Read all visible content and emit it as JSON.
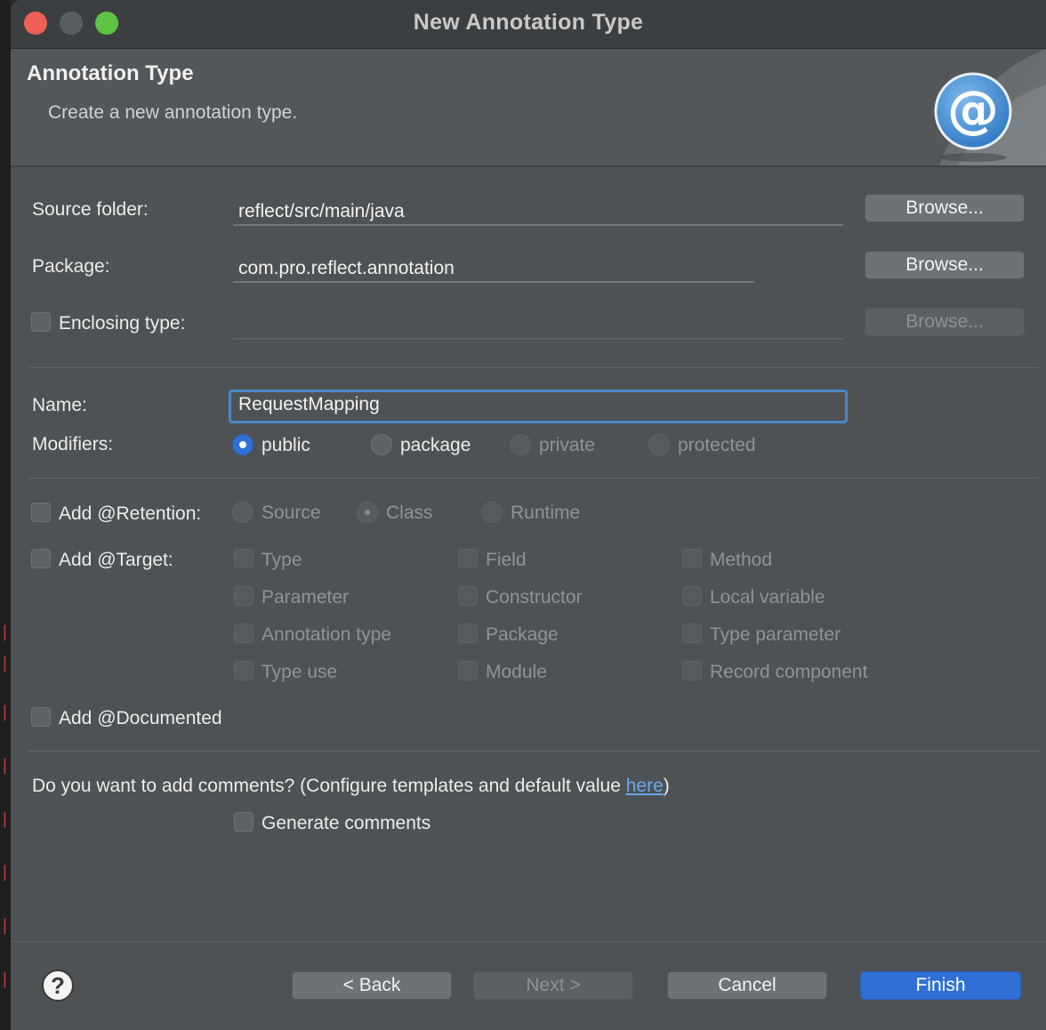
{
  "window": {
    "title": "New Annotation Type"
  },
  "header": {
    "title": "Annotation Type",
    "description": "Create a new annotation type.",
    "icon": "at-sign-icon"
  },
  "source_folder": {
    "label": "Source folder:",
    "value": "reflect/src/main/java",
    "browse": "Browse..."
  },
  "package": {
    "label": "Package:",
    "value": "com.pro.reflect.annotation",
    "browse": "Browse..."
  },
  "enclosing": {
    "label": "Enclosing type:",
    "value": "",
    "browse": "Browse...",
    "checked": false
  },
  "name": {
    "label": "Name:",
    "value": "RequestMapping"
  },
  "modifiers": {
    "label": "Modifiers:",
    "options": [
      "public",
      "package",
      "private",
      "protected"
    ],
    "selected": "public"
  },
  "retention": {
    "label": "Add @Retention:",
    "options": [
      "Source",
      "Class",
      "Runtime"
    ],
    "selected": "Class"
  },
  "target": {
    "label": "Add @Target:",
    "options": [
      "Type",
      "Field",
      "Method",
      "Parameter",
      "Constructor",
      "Local variable",
      "Annotation type",
      "Package",
      "Type parameter",
      "Type use",
      "Module",
      "Record component"
    ]
  },
  "documented": {
    "label": "Add @Documented"
  },
  "comments": {
    "question": "Do you want to add comments? (Configure templates and default value ",
    "link": "here",
    "close": ")",
    "generate": "Generate comments"
  },
  "footer": {
    "help": "?",
    "back": "< Back",
    "next": "Next >",
    "cancel": "Cancel",
    "finish": "Finish"
  },
  "colors": {
    "accent": "#2f6fd6",
    "focus_border": "#4a88c7",
    "link": "#6aa9ee",
    "dialog_bg": "#4e5254"
  }
}
